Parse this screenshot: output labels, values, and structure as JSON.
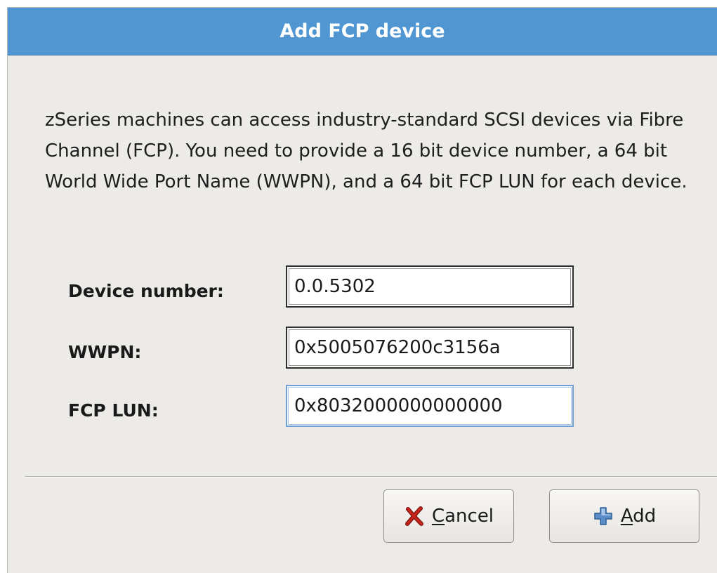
{
  "dialog": {
    "title": "Add FCP device",
    "description": "zSeries machines can access industry-standard SCSI devices via Fibre Channel (FCP). You need to provide a 16 bit device number, a 64 bit World Wide Port Name (WWPN), and a 64 bit FCP LUN for each device."
  },
  "form": {
    "device_number": {
      "label": "Device number:",
      "value": "0.0.5302"
    },
    "wwpn": {
      "label": "WWPN:",
      "value": "0x5005076200c3156a"
    },
    "fcp_lun": {
      "label": "FCP LUN:",
      "value": "0x8032000000000000",
      "focused": true
    }
  },
  "buttons": {
    "cancel": {
      "mnemonic": "C",
      "label_rest": "ancel",
      "icon": "x-cancel-icon",
      "icon_color": "#c8261b"
    },
    "add": {
      "mnemonic": "A",
      "label_rest": "dd",
      "icon": "plus-add-icon",
      "icon_color": "#5b8dc9"
    }
  },
  "colors": {
    "titlebar": "#4f96d3",
    "dialog_background": "#edebe8",
    "focus_border": "#6f9fd6"
  }
}
